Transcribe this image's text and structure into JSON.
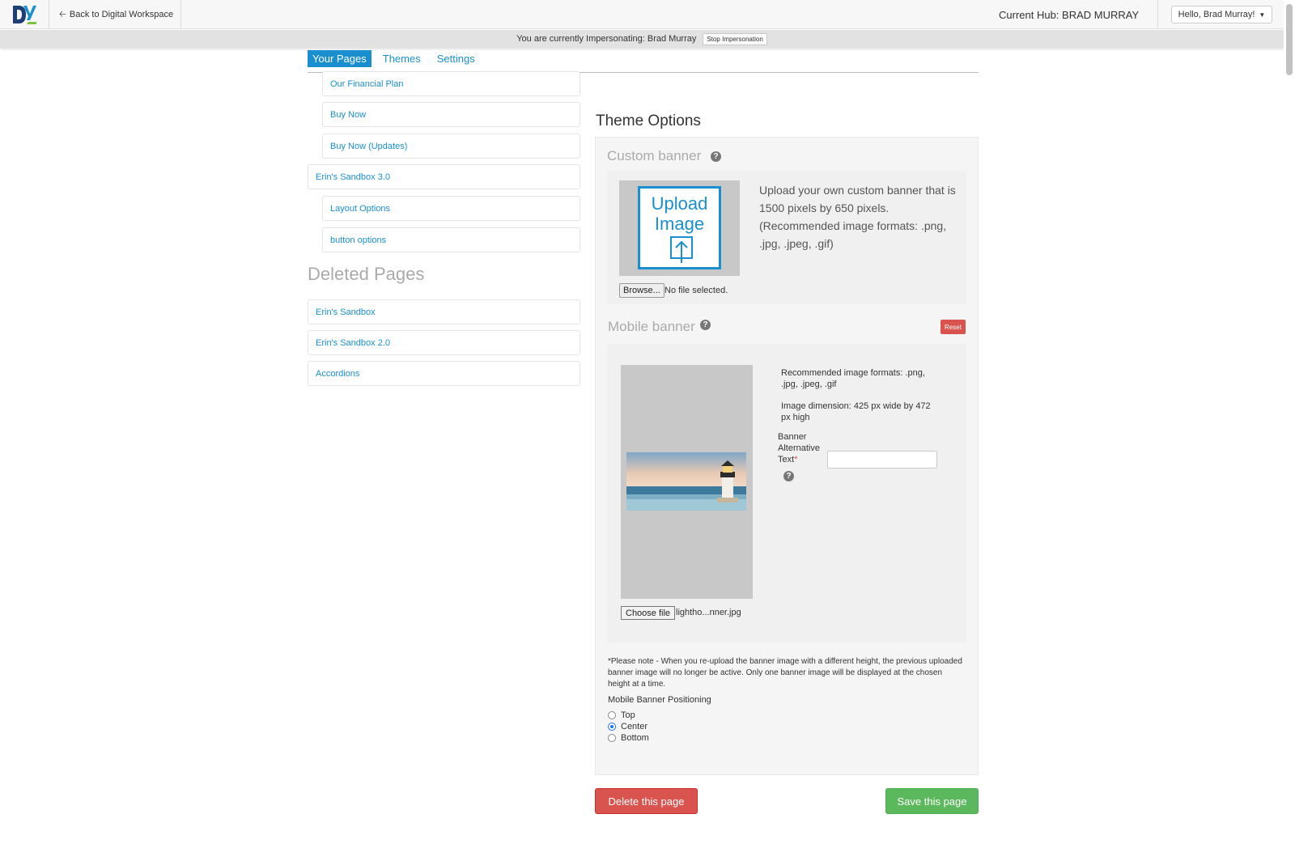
{
  "topbar": {
    "back_label": "Back to Digital Workspace",
    "current_hub": "Current Hub: BRAD MURRAY",
    "user_menu": "Hello, Brad Murray!"
  },
  "impersonation": {
    "text": "You are currently Impersonating: Brad Murray",
    "stop_label": "Stop Impersonation"
  },
  "nav": {
    "tabs": [
      {
        "label": "Your Pages",
        "active": true
      },
      {
        "label": "Themes",
        "active": false
      },
      {
        "label": "Settings",
        "active": false
      }
    ]
  },
  "pages": {
    "items": [
      {
        "label": "Our Financial Plan",
        "indent": true
      },
      {
        "label": "Buy Now",
        "indent": true
      },
      {
        "label": "Buy Now (Updates)",
        "indent": true
      },
      {
        "label": "Erin's Sandbox 3.0",
        "indent": false
      },
      {
        "label": "Layout Options",
        "indent": true
      },
      {
        "label": "button options",
        "indent": true
      }
    ],
    "deleted_title": "Deleted Pages",
    "deleted_items": [
      {
        "label": "Erin's Sandbox"
      },
      {
        "label": "Erin's Sandbox 2.0"
      },
      {
        "label": "Accordions"
      }
    ]
  },
  "theme_options": {
    "title": "Theme Options",
    "custom_banner": {
      "label": "Custom banner",
      "upload_text": "Upload Image",
      "description": "Upload your own custom banner that is 1500 pixels by 650 pixels. (Recommended image formats: .png, .jpg, .jpeg, .gif)",
      "browse_label": "Browse...",
      "no_file": "No file selected."
    },
    "mobile_banner": {
      "label": "Mobile banner",
      "reset_label": "Reset",
      "rec_formats": "Recommended image formats: .png, .jpg, .jpeg, .gif",
      "dimension": "Image dimension: 425 px wide by 472 px high",
      "alt_label": "Banner Alternative Text",
      "alt_required": "*",
      "alt_value": "",
      "choose_label": "Choose file",
      "chosen_file": "lightho...nner.jpg"
    },
    "note": "*Please note - When you re-upload the banner image with a different height, the previous uploaded banner image will no longer be active. Only one banner image will be displayed at the chosen height at a time.",
    "positioning": {
      "label": "Mobile Banner Positioning",
      "options": [
        {
          "label": "Top",
          "checked": false
        },
        {
          "label": "Center",
          "checked": true
        },
        {
          "label": "Bottom",
          "checked": false
        }
      ]
    }
  },
  "actions": {
    "delete_label": "Delete this page",
    "save_label": "Save this page"
  },
  "colors": {
    "accent": "#1a8fcf",
    "danger": "#d9534f",
    "success": "#5cb85c"
  }
}
